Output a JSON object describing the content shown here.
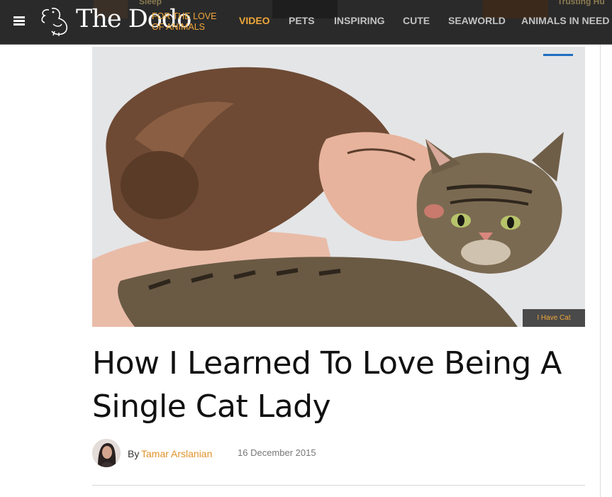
{
  "header": {
    "logo_word": "The Dodo",
    "logo_tag_line1": "FOR THE LOVE",
    "logo_tag_line2": "OF ANIMALS",
    "nav": [
      {
        "label": "VIDEO",
        "active": true
      },
      {
        "label": "PETS",
        "active": false
      },
      {
        "label": "INSPIRING",
        "active": false
      },
      {
        "label": "CUTE",
        "active": false
      },
      {
        "label": "SEAWORLD",
        "active": false
      },
      {
        "label": "ANIMALS IN NEED",
        "active": false
      }
    ],
    "teaser_left": "Sleep",
    "teaser_right": "Trusting Hu"
  },
  "hero": {
    "tag": "I Have Cat"
  },
  "article": {
    "title": "How I Learned To Love Being A Single Cat Lady",
    "by_label": "By",
    "author": "Tamar Arslanian",
    "date": "16 December 2015"
  },
  "colors": {
    "header_bg": "#2a2a2a",
    "accent": "#f0a73a",
    "nav_text": "#c2c2c2",
    "author_link": "#e0932a"
  },
  "icons": [
    "menu-icon",
    "dodo-bird-logo-icon"
  ]
}
